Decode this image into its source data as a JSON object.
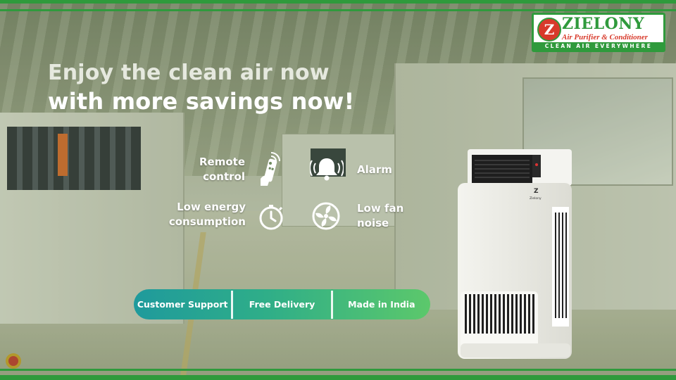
{
  "headline": {
    "line1": "Enjoy the clean air now",
    "line2": "with more savings now!"
  },
  "logo": {
    "mark": "Z",
    "brand": "ZIELONY",
    "tagline": "Air Purifier & Conditioner",
    "slogan": "CLEAN AIR EVERYWHERE"
  },
  "features": [
    {
      "label": "Remote control",
      "line1": "Remote",
      "line2": "control",
      "icon": "remote-icon"
    },
    {
      "label": "Alarm",
      "line1": "Alarm",
      "icon": "bell-icon"
    },
    {
      "label": "Low energy consumption",
      "line1": "Low energy",
      "line2": "consumption",
      "icon": "timer-icon"
    },
    {
      "label": "Low fan noise",
      "line1": "Low fan",
      "line2": "noise",
      "icon": "fan-icon"
    }
  ],
  "benefits": [
    "Customer Support",
    "Free Delivery",
    "Made in India"
  ],
  "product": {
    "badge": "Z",
    "name": "Zielony"
  },
  "colors": {
    "brand_green": "#2f9a3c",
    "brand_red": "#d83a2b",
    "pill_start": "#1f9a9c",
    "pill_end": "#5cc86b"
  }
}
